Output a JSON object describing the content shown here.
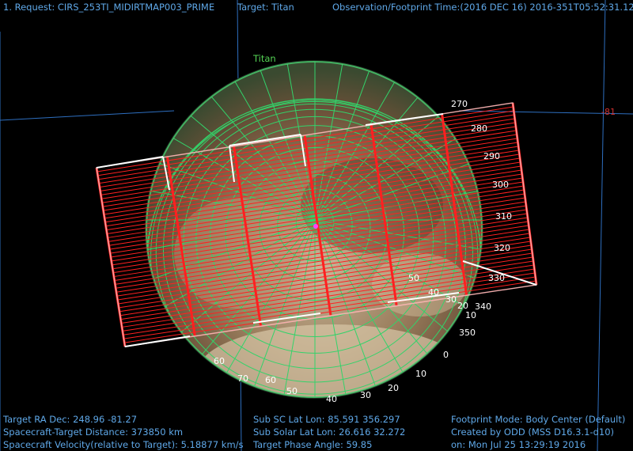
{
  "header": {
    "request": "1. Request: CIRS_253TI_MIDIRTMAP003_PRIME",
    "target": "Target: Titan",
    "time": "Observation/Footprint Time:(2016 DEC 16) 2016-351T05:52:31.12"
  },
  "body_label": "Titan",
  "sky_grid_label": "-81",
  "longitude_labels": [
    "270",
    "280",
    "290",
    "300",
    "310",
    "320",
    "330",
    "340",
    "350",
    "0",
    "10",
    "20",
    "30",
    "40",
    "50",
    "60",
    "70",
    "60"
  ],
  "latitude_labels": [
    "10",
    "20",
    "30",
    "40",
    "50"
  ],
  "footer_left": {
    "ra_dec": "Target RA Dec: 248.96   -81.27",
    "distance": "Spacecraft-Target Distance:  373850 km",
    "velocity": "Spacecraft Velocity(relative to Target): 5.18877 km/s"
  },
  "footer_mid": {
    "sub_sc": "Sub SC Lat Lon: 85.591  356.297",
    "sub_solar": "Sub Solar Lat Lon: 26.616  32.272",
    "phase": "Target Phase Angle: 59.85"
  },
  "footer_right": {
    "mode": "Footprint Mode: Body Center (Default)",
    "created": "Created by ODD (MSS D16.3.1-d10)",
    "on": "on: Mon Jul 25 13:29:19 2016"
  },
  "colors": {
    "hud_text": "#5fa8e8",
    "grid": "#33d36a",
    "footprint": "#ff2020",
    "footprint_outline": "#ffffff",
    "sky_grid": "#2e6fc0"
  }
}
